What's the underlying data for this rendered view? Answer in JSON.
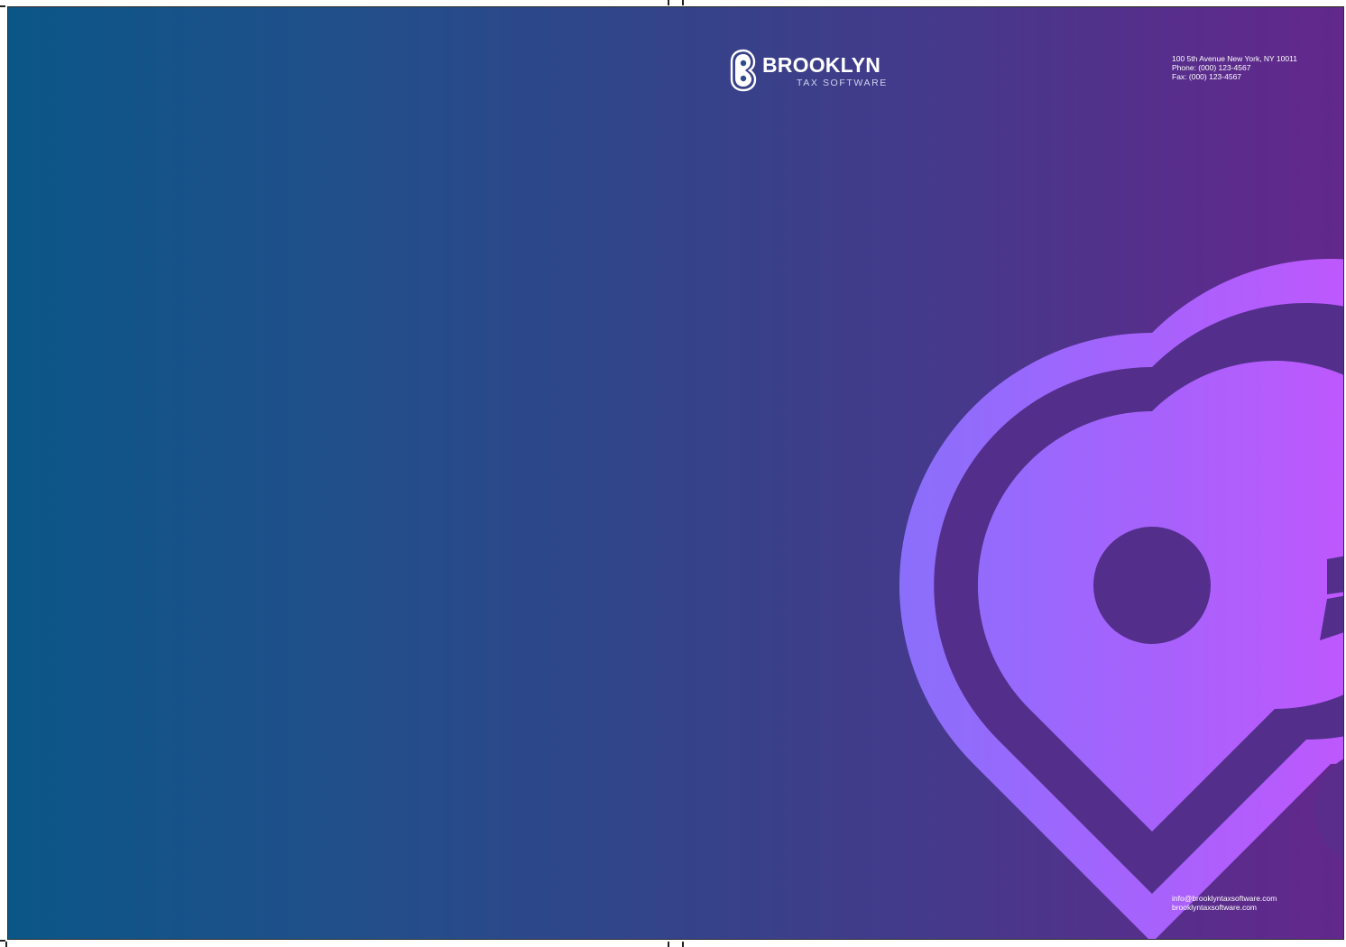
{
  "brand": {
    "name": "BROOKLYN",
    "tagline": "TAX SOFTWARE",
    "logo_icon": "b-monogram-icon"
  },
  "contact": {
    "address": "100 5th Avenue New York, NY 10011",
    "phone": "Phone: (000) 123-4567",
    "fax": "Fax: (000) 123-4567"
  },
  "web": {
    "email": "info@brooklyntaxsoftware.com",
    "website": "brooklyntaxsoftware.com"
  },
  "colors": {
    "gradient_start": "#0b5687",
    "gradient_end": "#62288b",
    "art_light_start": "#8a6ffb",
    "art_light_end": "#bd58fd",
    "art_dark": "#532e8b"
  }
}
